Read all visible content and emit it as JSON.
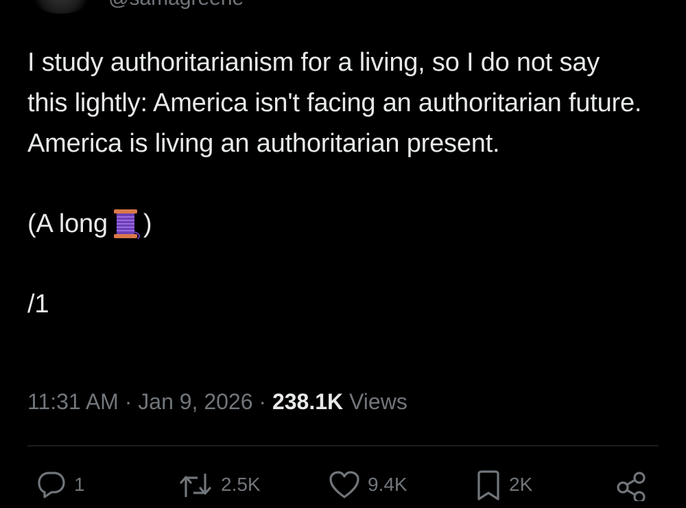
{
  "author": {
    "handle": "@samagreene"
  },
  "tweet": {
    "main_text": "I study authoritarianism for a living, so I do not say this lightly: America isn't facing an authoritarian future. America is living an authoritarian present.",
    "thread_prefix": "(A long",
    "thread_icon": "spool-of-thread-emoji",
    "thread_suffix": ")",
    "thread_count": "/1"
  },
  "meta": {
    "time": "11:31 AM",
    "separator_1": " · ",
    "date": "Jan 9, 2026",
    "separator_2": " · ",
    "views_count": "238.1K",
    "views_label": " Views"
  },
  "actions": {
    "reply_count": "1",
    "repost_count": "2.5K",
    "like_count": "9.4K",
    "bookmark_count": "2K"
  },
  "colors": {
    "background": "#000000",
    "text": "#e7e9ea",
    "secondary": "#71767b",
    "divider": "#2f3336"
  }
}
